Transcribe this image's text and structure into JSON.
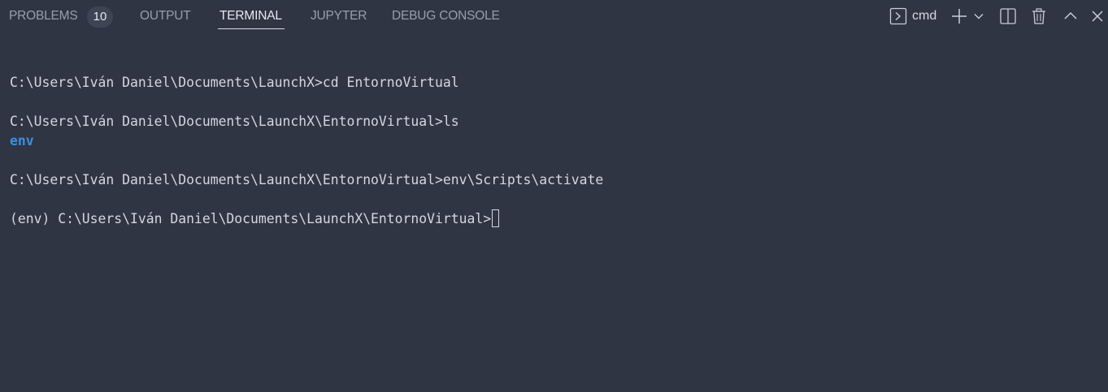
{
  "tabs": [
    {
      "label": "PROBLEMS",
      "active": false
    },
    {
      "label": "OUTPUT",
      "active": false
    },
    {
      "label": "TERMINAL",
      "active": true
    },
    {
      "label": "JUPYTER",
      "active": false
    },
    {
      "label": "DEBUG CONSOLE",
      "active": false
    }
  ],
  "problems_count": "10",
  "actions": {
    "shell_label": "cmd",
    "icons": [
      "terminal-icon",
      "plus-icon",
      "chevron-down-icon",
      "split-icon",
      "trash-icon",
      "chevron-up-icon",
      "close-icon"
    ]
  },
  "terminal": {
    "lines": [
      "C:\\Users\\Iván Daniel\\Documents\\LaunchX>cd EntornoVirtual",
      "C:\\Users\\Iván Daniel\\Documents\\LaunchX\\EntornoVirtual>ls",
      "env",
      "C:\\Users\\Iván Daniel\\Documents\\LaunchX\\EntornoVirtual>env\\Scripts\\activate",
      "(env) C:\\Users\\Iván Daniel\\Documents\\LaunchX\\EntornoVirtual>"
    ]
  },
  "colors": {
    "background": "#2f3543",
    "text": "#d3d7df",
    "inactive_tab": "#979eac",
    "directory": "#3c8fe0"
  }
}
